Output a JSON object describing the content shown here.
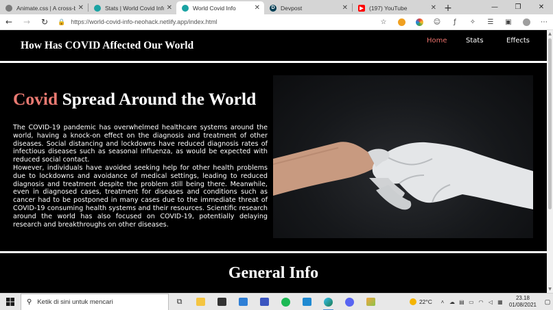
{
  "browser": {
    "tabs": [
      {
        "label": "Animate.css | A cross-brow",
        "favicon_color": "#7a7a7a",
        "active": false
      },
      {
        "label": "Stats | World Covid Info",
        "favicon_color": "#1aa3a3",
        "active": false
      },
      {
        "label": "World Covid Info",
        "favicon_color": "#1aa3a3",
        "active": true
      },
      {
        "label": "Devpost",
        "favicon_color": "#003e54",
        "active": false
      },
      {
        "label": "(197) YouTube",
        "favicon_color": "#ff0000",
        "active": false
      }
    ],
    "new_tab_glyph": "+",
    "url_host": "https://world-covid-info-neohack.netlify.app",
    "url_path": "/index.html"
  },
  "site": {
    "brand": "How Has COVID Affected Our World",
    "nav": {
      "home": "Home",
      "stats": "Stats",
      "effects": "Effects"
    },
    "accent_color": "#ea7a72",
    "hero": {
      "title_accent": "Covid",
      "title_rest": " Spread Around the World",
      "paragraph1": "The COVID-19 pandemic has overwhelmed healthcare systems around the world, having a knock-on effect on the diagnosis and treatment of other diseases. Social distancing and lockdowns have reduced diagnosis rates of infectious diseases such as seasonal influenza, as would be expected with reduced social contact.",
      "paragraph2": "However, individuals have avoided seeking help for other health problems due to lockdowns and avoidance of medical settings, leading to reduced diagnosis and treatment despite the problem still being there. Meanwhile, even in diagnosed cases, treatment for diseases and conditions such as cancer had to be postponed in many cases due to the immediate threat of COVID-19 consuming health systems and their resources. Scientific research around the world has also focused on COVID-19, potentially delaying research and breakthroughs on other diseases."
    },
    "section_title": "General Info"
  },
  "taskbar": {
    "search_placeholder": "Ketik di sini untuk mencari",
    "weather": "22°C",
    "time": "23.18",
    "date": "01/08/2021"
  }
}
